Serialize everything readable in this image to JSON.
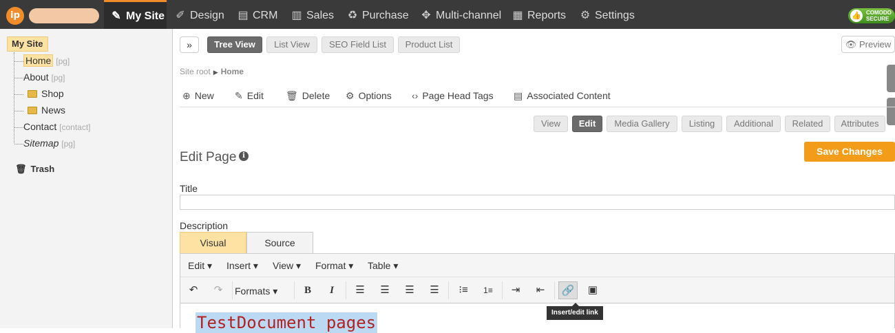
{
  "topbar": {
    "logo": "ip",
    "nav": [
      {
        "label": "My Site",
        "icon": "✎",
        "icon_name": "site-edit-icon"
      },
      {
        "label": "Design",
        "icon": "✐",
        "icon_name": "brush-icon"
      },
      {
        "label": "CRM",
        "icon": "▤",
        "icon_name": "contacts-icon"
      },
      {
        "label": "Sales",
        "icon": "▥",
        "icon_name": "bar-people-icon"
      },
      {
        "label": "Purchase",
        "icon": "♻",
        "icon_name": "purchase-icon"
      },
      {
        "label": "Multi-channel",
        "icon": "✥",
        "icon_name": "network-icon"
      },
      {
        "label": "Reports",
        "icon": "▦",
        "icon_name": "chart-icon"
      },
      {
        "label": "Settings",
        "icon": "⚙",
        "icon_name": "gear-icon"
      }
    ],
    "secure_badge": [
      "COMODO",
      "SECURE"
    ]
  },
  "sidebar": {
    "root": "My Site",
    "nodes": [
      {
        "label": "Home",
        "tag": "[pg]"
      },
      {
        "label": "About",
        "tag": "[pg]"
      },
      {
        "label": "Shop",
        "tag": ""
      },
      {
        "label": "News",
        "tag": ""
      },
      {
        "label": "Contact",
        "tag": "[contact]"
      },
      {
        "label": "Sitemap",
        "tag": "[pg]"
      }
    ],
    "trash": "Trash"
  },
  "viewtabs": [
    "Tree View",
    "List View",
    "SEO Field List",
    "Product List"
  ],
  "preview": "Preview",
  "breadcrumb": {
    "root": "Site root",
    "current": "Home"
  },
  "actions": [
    {
      "label": "New",
      "icon": "⊕",
      "icon_name": "plus-circle-icon"
    },
    {
      "label": "Edit",
      "icon": "✎",
      "icon_name": "pencil-icon"
    },
    {
      "label": "Delete",
      "icon": "🗑",
      "icon_name": "trash-icon"
    },
    {
      "label": "Options",
      "icon": "⚙",
      "icon_name": "gear-icon"
    },
    {
      "label": "Page Head Tags",
      "icon": "‹›",
      "icon_name": "code-icon"
    },
    {
      "label": "Associated Content",
      "icon": "▤",
      "icon_name": "content-icon"
    }
  ],
  "pagetabs": [
    "View",
    "Edit",
    "Media Gallery",
    "Listing",
    "Additional",
    "Related",
    "Attributes"
  ],
  "edit_page": {
    "title": "Edit Page",
    "save": "Save Changes",
    "title_label": "Title",
    "title_value": "",
    "description_label": "Description"
  },
  "editor": {
    "tabs": [
      "Visual",
      "Source"
    ],
    "menus": [
      "Edit",
      "Insert",
      "View",
      "Format",
      "Table"
    ],
    "formats": "Formats",
    "tooltip": "Insert/edit link",
    "content": "TestDocument pages"
  },
  "colors": {
    "accent": "#f08c2a",
    "save": "#f39c1a",
    "highlight": "#fde2a4",
    "topbar": "#3a3a3a"
  }
}
